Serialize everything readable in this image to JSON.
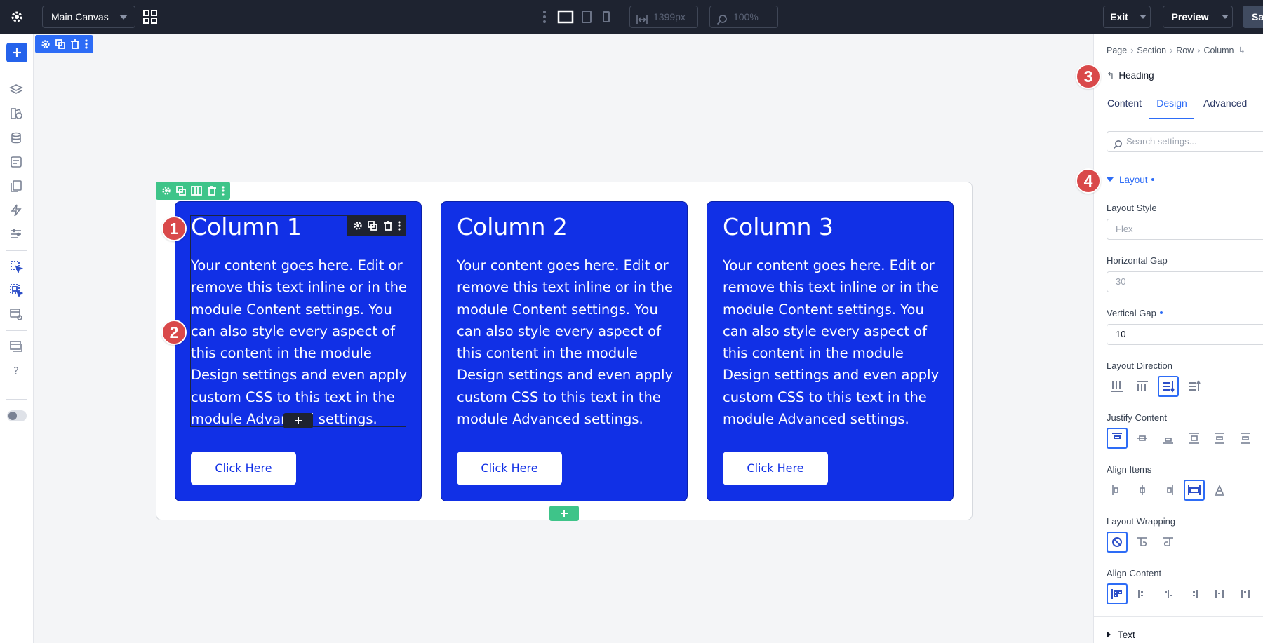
{
  "topbar": {
    "canvas_select": "Main Canvas",
    "width_value": "1399px",
    "zoom_value": "100%",
    "exit_label": "Exit",
    "preview_label": "Preview",
    "save_label": "Sav"
  },
  "canvas": {
    "columns": [
      {
        "title": "Column 1",
        "body": "Your content goes here. Edit or remove this text inline or in the module Content settings. You can also style every aspect of this content in the module Design settings and even apply custom CSS to this text in the module Advanced settings.",
        "button": "Click Here"
      },
      {
        "title": "Column 2",
        "body": "Your content goes here. Edit or remove this text inline or in the module Content settings. You can also style every aspect of this content in the module Design settings and even apply custom CSS to this text in the module Advanced settings.",
        "button": "Click Here"
      },
      {
        "title": "Column 3",
        "body": "Your content goes here. Edit or remove this text inline or in the module Content settings. You can also style every aspect of this content in the module Design settings and even apply custom CSS to this text in the module Advanced settings.",
        "button": "Click Here"
      }
    ],
    "column_color": "#1130e6"
  },
  "badges": [
    "1",
    "2",
    "3",
    "4"
  ],
  "panel": {
    "breadcrumb": [
      "Page",
      "Section",
      "Row",
      "Column"
    ],
    "module": "Heading",
    "tabs": [
      "Content",
      "Design",
      "Advanced"
    ],
    "active_tab": "Design",
    "search_placeholder": "Search settings...",
    "section_layout": "Layout",
    "fields": {
      "layout_style_label": "Layout Style",
      "layout_style_value": "Flex",
      "horizontal_gap_label": "Horizontal Gap",
      "horizontal_gap_value": "30",
      "vertical_gap_label": "Vertical Gap",
      "vertical_gap_value": "10",
      "layout_direction_label": "Layout Direction",
      "justify_content_label": "Justify Content",
      "align_items_label": "Align Items",
      "layout_wrapping_label": "Layout Wrapping",
      "align_content_label": "Align Content"
    },
    "section_text": "Text",
    "accent_color": "#2d6cf6"
  }
}
